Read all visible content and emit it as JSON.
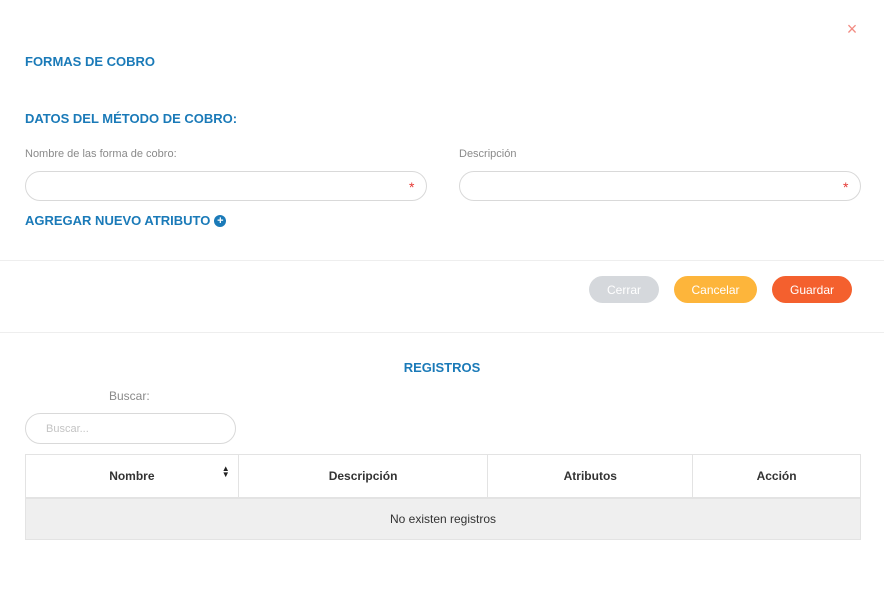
{
  "modal": {
    "title": "FORMAS DE COBRO",
    "close_icon": "×"
  },
  "form": {
    "section_title": "DATOS DEL MÉTODO DE COBRO:",
    "name_label": "Nombre de las forma de cobro:",
    "name_value": "",
    "description_label": "Descripción",
    "description_value": "",
    "required_mark": "*",
    "add_attribute_label": "AGREGAR NUEVO ATRIBUTO",
    "add_attribute_icon": "plus-circle-icon"
  },
  "actions": {
    "close_label": "Cerrar",
    "cancel_label": "Cancelar",
    "save_label": "Guardar"
  },
  "colors": {
    "accent": "#1a7ab8",
    "close_button": "#d5d8dc",
    "cancel_button": "#fdb53b",
    "save_button": "#f4602e",
    "close_icon": "#f28b82"
  },
  "records": {
    "title": "REGISTROS",
    "search_label": "Buscar:",
    "search_placeholder": "Buscar...",
    "columns": [
      "Nombre",
      "Descripción",
      "Atributos",
      "Acción"
    ],
    "empty_message": "No existen registros"
  }
}
